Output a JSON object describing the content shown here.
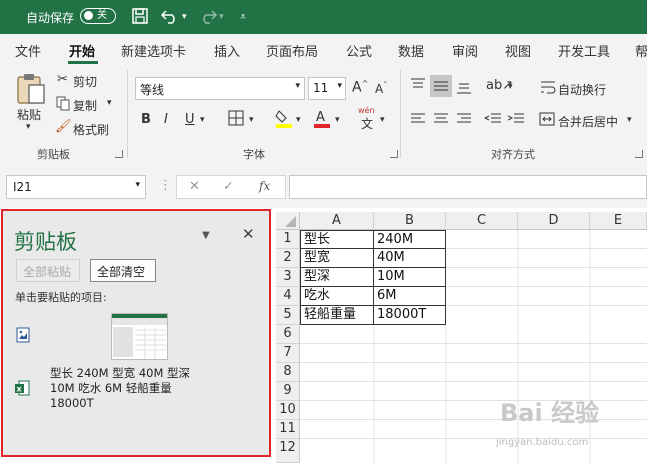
{
  "titlebar": {
    "autosave_label": "自动保存",
    "toggle_state": "关"
  },
  "tabs": [
    "文件",
    "开始",
    "新建选项卡",
    "插入",
    "页面布局",
    "公式",
    "数据",
    "审阅",
    "视图",
    "开发工具",
    "帮"
  ],
  "ribbon": {
    "paste": "粘贴",
    "cut": "剪切",
    "copy": "复制",
    "format_painter": "格式刷",
    "font_name": "等线",
    "font_size": "11",
    "wrap_text": "自动换行",
    "merge_center": "合并后居中",
    "groups": {
      "clipboard": "剪贴板",
      "font": "字体",
      "alignment": "对齐方式"
    },
    "wen_label": "wén",
    "wen_char": "文"
  },
  "formula": {
    "name_box": "I21",
    "fx": "fx",
    "value": ""
  },
  "clipboard_pane": {
    "title": "剪贴板",
    "paste_all": "全部粘贴",
    "clear_all": "全部清空",
    "instruction": "单击要粘贴的项目:",
    "items": [
      {
        "type": "image",
        "icon": "image-paste-icon"
      },
      {
        "type": "excel",
        "icon": "excel-icon",
        "text": "型长 240M 型宽 40M 型深 10M 吃水 6M 轻船重量 18000T"
      }
    ]
  },
  "sheet": {
    "columns": [
      "A",
      "B",
      "C",
      "D",
      "E"
    ],
    "rows": [
      "1",
      "2",
      "3",
      "4",
      "5",
      "6",
      "7",
      "8",
      "9",
      "10",
      "11",
      "12"
    ],
    "data": [
      [
        "型长",
        "240M"
      ],
      [
        "型宽",
        "40M"
      ],
      [
        "型深",
        "10M"
      ],
      [
        "吃水",
        "6M"
      ],
      [
        "轻船重量",
        "18000T"
      ]
    ]
  },
  "watermark": {
    "main": "Bai 经验",
    "sub": "jingyan.baidu.com"
  },
  "colors": {
    "excel_green": "#217346",
    "pane_border": "#e0262b"
  }
}
